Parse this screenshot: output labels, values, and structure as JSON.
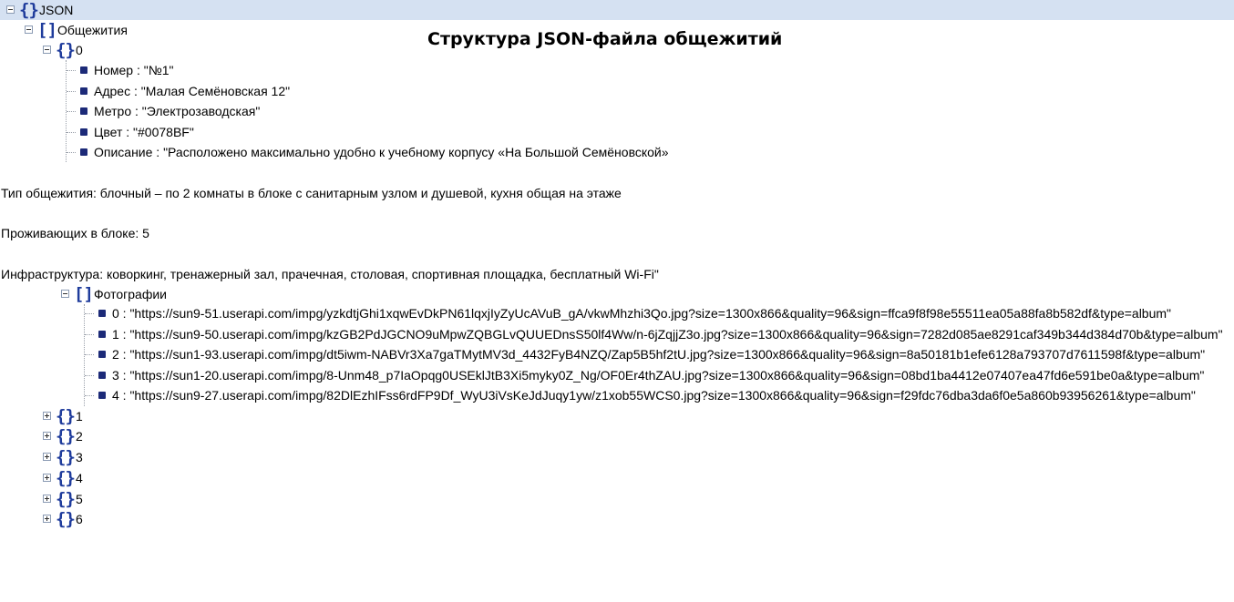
{
  "title": "Структура JSON-файла общежитий",
  "root": {
    "label": "JSON"
  },
  "dorms_node": {
    "label": "Общежития"
  },
  "item0": {
    "label": "0",
    "fields": [
      "Номер : \"№1\"",
      "Адрес : \"Малая Семёновская 12\"",
      "Метро : \"Электрозаводская\"",
      "Цвет : \"#0078BF\"",
      "Описание : \"Расположено максимально удобно к учебному корпусу «На Большой Семёновской»"
    ],
    "paragraphs": [
      "Тип общежития: блочный – по 2 комнаты в блоке с санитарным узлом и душевой, кухня общая на этаже",
      "Проживающих в блоке: 5",
      "Инфраструктура: коворкинг, тренажерный зал, прачечная, столовая, спортивная площадка, бесплатный Wi-Fi\""
    ],
    "photos_label": "Фотографии",
    "photos": [
      "0 : \"https://sun9-51.userapi.com/impg/yzkdtjGhi1xqwEvDkPN61lqxjIyZyUcAVuB_gA/vkwMhzhi3Qo.jpg?size=1300x866&quality=96&sign=ffca9f8f98e55511ea05a88fa8b582df&type=album\"",
      "1 : \"https://sun9-50.userapi.com/impg/kzGB2PdJGCNO9uMpwZQBGLvQUUEDnsS50lf4Ww/n-6jZqjjZ3o.jpg?size=1300x866&quality=96&sign=7282d085ae8291caf349b344d384d70b&type=album\"",
      "2 : \"https://sun1-93.userapi.com/impg/dt5iwm-NABVr3Xa7gaTMytMV3d_4432FyB4NZQ/Zap5B5hf2tU.jpg?size=1300x866&quality=96&sign=8a50181b1efe6128a793707d7611598f&type=album\"",
      "3 : \"https://sun1-20.userapi.com/impg/8-Unm48_p7IaOpqg0USEklJtB3Xi5myky0Z_Ng/OF0Er4thZAU.jpg?size=1300x866&quality=96&sign=08bd1ba4412e07407ea47fd6e591be0a&type=album\"",
      "4 : \"https://sun9-27.userapi.com/impg/82DlEzhIFss6rdFP9Df_WyU3iVsKeJdJuqy1yw/z1xob55WCS0.jpg?size=1300x866&quality=96&sign=f29fdc76dba3da6f0e5a860b93956261&type=album\""
    ]
  },
  "collapsed_items": [
    "1",
    "2",
    "3",
    "4",
    "5",
    "6"
  ]
}
